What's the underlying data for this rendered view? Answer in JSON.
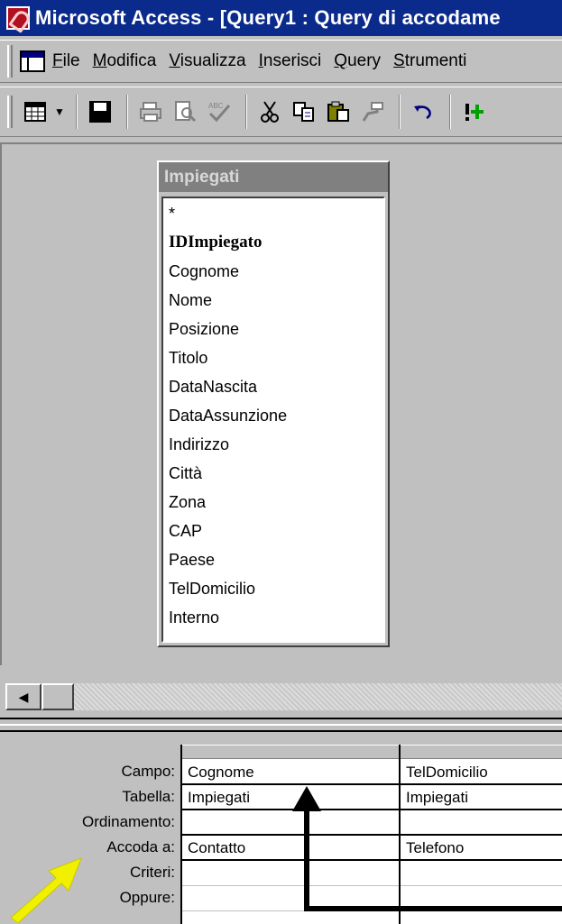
{
  "window": {
    "title": "Microsoft Access - [Query1 : Query di accodame"
  },
  "menu": {
    "items": [
      {
        "label": "File",
        "mnemonic": "F",
        "rest": "ile"
      },
      {
        "label": "Modifica",
        "mnemonic": "M",
        "rest": "odifica"
      },
      {
        "label": "Visualizza",
        "mnemonic": "V",
        "rest": "isualizza"
      },
      {
        "label": "Inserisci",
        "mnemonic": "I",
        "rest": "nserisci"
      },
      {
        "label": "Query",
        "mnemonic": "Q",
        "rest": "uery"
      },
      {
        "label": "Strumenti",
        "mnemonic": "S",
        "rest": "trumenti"
      }
    ]
  },
  "toolbar": {
    "icons": [
      "view-datasheet-icon",
      "dropdown-arrow-icon",
      "save-icon",
      "print-icon",
      "print-preview-icon",
      "spelling-icon",
      "cut-icon",
      "copy-icon",
      "paste-icon",
      "format-painter-icon",
      "undo-icon",
      "run-icon"
    ]
  },
  "field_list": {
    "table_name": "Impiegati",
    "fields": [
      "*",
      "IDImpiegato",
      "Cognome",
      "Nome",
      "Posizione",
      "Titolo",
      "DataNascita",
      "DataAssunzione",
      "Indirizzo",
      "Città",
      "Zona",
      "CAP",
      "Paese",
      "TelDomicilio",
      "Interno"
    ],
    "primary_key": "IDImpiegato"
  },
  "grid": {
    "row_labels": {
      "campo": "Campo:",
      "tabella": "Tabella:",
      "ordinamento": "Ordinamento:",
      "accoda": "Accoda a:",
      "criteri": "Criteri:",
      "oppure": "Oppure:"
    },
    "columns": [
      {
        "campo": "Cognome",
        "tabella": "Impiegati",
        "ordinamento": "",
        "accoda": "Contatto",
        "criteri": "",
        "oppure": ""
      },
      {
        "campo": "TelDomicilio",
        "tabella": "Impiegati",
        "ordinamento": "",
        "accoda": "Telefono",
        "criteri": "",
        "oppure": ""
      }
    ]
  },
  "annotations": {
    "yellow_arrow_color": "#f0f000",
    "black_arrow_color": "#000000"
  }
}
